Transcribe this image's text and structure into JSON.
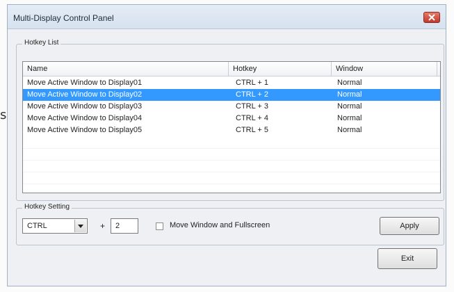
{
  "stray_char": "s",
  "window": {
    "title": "Multi-Display Control Panel"
  },
  "hotkey_list": {
    "group_title": "Hotkey List",
    "columns": [
      "Name",
      "Hotkey",
      "Window"
    ],
    "rows": [
      {
        "name": "Move Active Window to Display01",
        "hotkey": "CTRL + 1",
        "window": "Normal",
        "selected": false
      },
      {
        "name": "Move Active Window to Display02",
        "hotkey": "CTRL + 2",
        "window": "Normal",
        "selected": true
      },
      {
        "name": "Move Active Window to Display03",
        "hotkey": "CTRL + 3",
        "window": "Normal",
        "selected": false
      },
      {
        "name": "Move Active Window to Display04",
        "hotkey": "CTRL + 4",
        "window": "Normal",
        "selected": false
      },
      {
        "name": "Move Active Window to Display05",
        "hotkey": "CTRL + 5",
        "window": "Normal",
        "selected": false
      }
    ]
  },
  "hotkey_setting": {
    "group_title": "Hotkey Setting",
    "modifier_value": "CTRL",
    "plus": "+",
    "key_value": "2",
    "checkbox_label": "Move Window and Fullscreen",
    "checkbox_checked": false,
    "apply_label": "Apply"
  },
  "exit_label": "Exit",
  "colors": {
    "selection": "#3399ff",
    "close_button": "#c0392b"
  }
}
